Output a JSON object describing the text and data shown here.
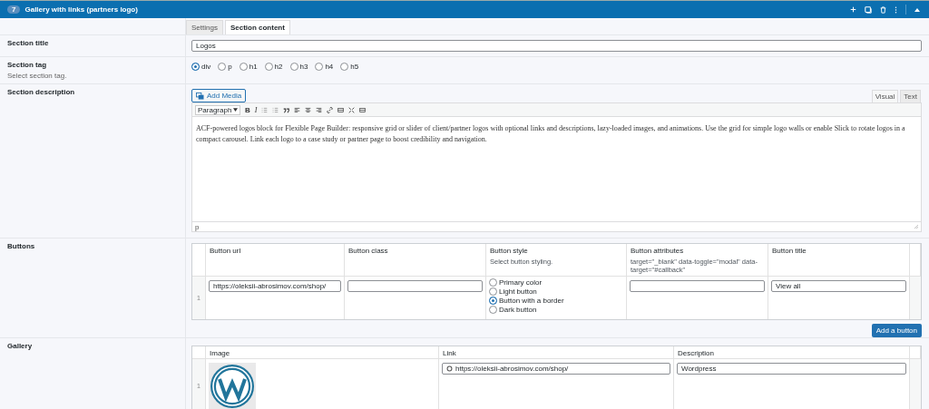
{
  "header": {
    "number": "7",
    "title": "Gallery with links (partners logo)"
  },
  "tabs": [
    {
      "label": "Settings",
      "selected": false
    },
    {
      "label": "Section content",
      "selected": true
    }
  ],
  "section_title": {
    "label": "Section title",
    "value": "Logos"
  },
  "section_tag": {
    "label": "Section tag",
    "hint": "Select section tag.",
    "options": [
      {
        "label": "div",
        "selected": true
      },
      {
        "label": "p",
        "selected": false
      },
      {
        "label": "h1",
        "selected": false
      },
      {
        "label": "h2",
        "selected": false
      },
      {
        "label": "h3",
        "selected": false
      },
      {
        "label": "h4",
        "selected": false
      },
      {
        "label": "h5",
        "selected": false
      }
    ]
  },
  "section_description": {
    "label": "Section description",
    "add_media": "Add Media",
    "editor_tabs": [
      {
        "label": "Visual",
        "selected": true
      },
      {
        "label": "Text",
        "selected": false
      }
    ],
    "format": "Paragraph",
    "bold": "B",
    "italic": "I",
    "content": "ACF-powered logos block for Flexible Page Builder: responsive grid or slider of client/partner logos with optional links and descriptions, lazy-loaded images, and animations. Use the grid for simple logo walls or enable Slick to rotate logos in a compact carousel. Link each logo to a case study or partner page to boost credibility and navigation.",
    "path": "p"
  },
  "buttons": {
    "label": "Buttons",
    "columns": [
      {
        "title": "Button url"
      },
      {
        "title": "Button class"
      },
      {
        "title": "Button style",
        "hint": "Select button styling."
      },
      {
        "title": "Button attributes",
        "hint": "target=\"_blank\" data-toggle=\"modal\" data-target=\"#callback\""
      },
      {
        "title": "Button title"
      }
    ],
    "rows": [
      {
        "index": "1",
        "url": "https://oleksii-abrosimov.com/shop/",
        "class": "",
        "styles": [
          {
            "label": "Primary color",
            "selected": false
          },
          {
            "label": "Light button",
            "selected": false
          },
          {
            "label": "Button with a border",
            "selected": true
          },
          {
            "label": "Dark button",
            "selected": false
          }
        ],
        "attributes": "",
        "title": "View all"
      }
    ],
    "add_button": "Add a button"
  },
  "gallery": {
    "label": "Gallery",
    "columns": [
      "Image",
      "Link",
      "Description"
    ],
    "rows": [
      {
        "index": "1",
        "link": "https://oleksii-abrosimov.com/shop/",
        "description": "Wordpress"
      }
    ]
  }
}
